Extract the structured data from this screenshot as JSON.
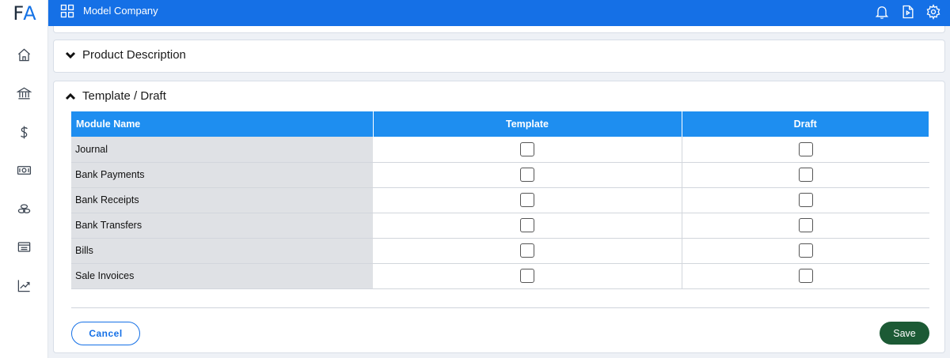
{
  "logo": {
    "f": "F",
    "a": "A"
  },
  "topbar": {
    "company": "Model Company"
  },
  "sidebar": {
    "items": [
      {
        "icon": "home-icon"
      },
      {
        "icon": "bank-icon"
      },
      {
        "icon": "dollar-icon"
      },
      {
        "icon": "cash-icon"
      },
      {
        "icon": "coins-icon"
      },
      {
        "icon": "list-icon"
      },
      {
        "icon": "chart-line-icon"
      }
    ]
  },
  "sections": {
    "product_description": {
      "title": "Product Description"
    },
    "template_draft": {
      "title": "Template / Draft"
    }
  },
  "table": {
    "headers": [
      "Module Name",
      "Template",
      "Draft"
    ],
    "rows": [
      {
        "name": "Journal",
        "template": false,
        "draft": false
      },
      {
        "name": "Bank Payments",
        "template": false,
        "draft": false
      },
      {
        "name": "Bank Receipts",
        "template": false,
        "draft": false
      },
      {
        "name": "Bank Transfers",
        "template": false,
        "draft": false
      },
      {
        "name": "Bills",
        "template": false,
        "draft": false
      },
      {
        "name": "Sale Invoices",
        "template": false,
        "draft": false
      }
    ]
  },
  "buttons": {
    "cancel": "Cancel",
    "save": "Save"
  },
  "colors": {
    "topbar": "#1570e6",
    "table_header": "#1e8ef0",
    "save": "#1c5a35",
    "accent": "#1570e6"
  }
}
